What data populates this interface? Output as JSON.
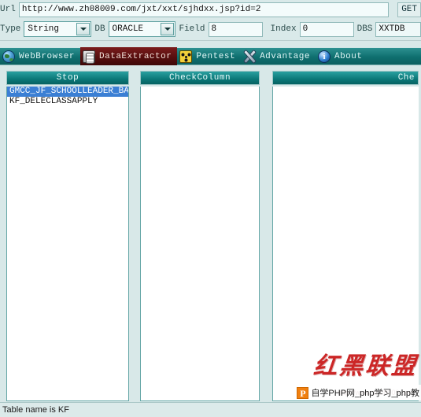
{
  "form": {
    "url_label": "Url",
    "url_value": "http://www.zh08009.com/jxt/xxt/sjhdxx.jsp?id=2",
    "get_button": "GET",
    "type_label": "Type",
    "type_value": "String",
    "db_label": "DB",
    "db_value": "ORACLE",
    "field_label": "Field",
    "field_value": "8",
    "index_label": "Index",
    "index_value": "0",
    "dbs_label": "DBS",
    "dbs_value": "XXTDB"
  },
  "nav": {
    "items": [
      {
        "label": "WebBrowser",
        "icon": "globe-icon",
        "active": false
      },
      {
        "label": "DataExtractor",
        "icon": "database-icon",
        "active": true
      },
      {
        "label": "Pentest",
        "icon": "radiation-icon",
        "active": false
      },
      {
        "label": "Advantage",
        "icon": "tools-icon",
        "active": false
      },
      {
        "label": "About",
        "icon": "info-icon",
        "active": false
      }
    ]
  },
  "panels": [
    {
      "header": "Stop",
      "items": [
        {
          "text": "GMCC_JF_SCHOOLLEADER_BAK",
          "selected": true
        },
        {
          "text": "KF_DELECLASSAPPLY",
          "selected": false
        }
      ]
    },
    {
      "header": "CheckColumn",
      "items": []
    },
    {
      "header": "Che",
      "items": []
    }
  ],
  "status": {
    "message": "Table name is KF"
  },
  "watermark": {
    "calligraphy": "红黑联盟",
    "url": "http://www.zh08009.com",
    "logo_letter": "P",
    "banner": "自学PHP网_php学习_php教"
  },
  "colors": {
    "nav_teal": "#0f6f6f",
    "active_tab_red": "#5a1010",
    "selection_blue": "#3b7fd4",
    "panel_header_teal": "#0b7878"
  }
}
